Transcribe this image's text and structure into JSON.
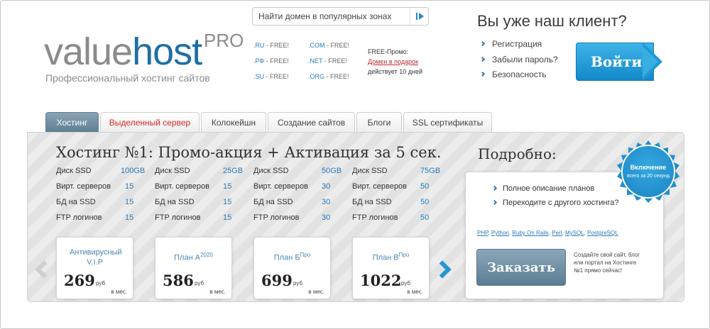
{
  "logo": {
    "part1": "value",
    "part2": "host",
    "pro": "PRO",
    "tagline": "Профессиональный хостинг сайтов"
  },
  "search": {
    "placeholder": "Найти домен в популярных зонах"
  },
  "zones": [
    {
      "zone": ".RU",
      "label": "- FREE!"
    },
    {
      "zone": ".COM",
      "label": "- FREE!"
    },
    {
      "zone": ".РФ",
      "label": "- FREE!"
    },
    {
      "zone": ".NET",
      "label": "- FREE!"
    },
    {
      "zone": ".SU",
      "label": "- FREE!"
    },
    {
      "zone": ".ORG",
      "label": "- FREE!"
    }
  ],
  "promo": {
    "line1": "FREE-Промо:",
    "link": "Домен в подарок",
    "line3": "действует 10 дней"
  },
  "client": {
    "title": "Вы уже наш клиент?",
    "links": [
      "Регистрация",
      "Забыли пароль?",
      "Безопасность"
    ],
    "login": "Войти"
  },
  "tabs": [
    {
      "label": "Хостинг",
      "active": true
    },
    {
      "label": "Выделенный сервер",
      "active": false
    },
    {
      "label": "Колокейшн",
      "active": false
    },
    {
      "label": "Создание сайтов",
      "active": false
    },
    {
      "label": "Блоги",
      "active": false
    },
    {
      "label": "SSL сертификаты",
      "active": false
    }
  ],
  "main": {
    "title": "Хостинг №1: Промо-акция + Активация за 5 сек.",
    "spec_labels": [
      "Диск SSD",
      "Вирт. серверов",
      "БД на SSD",
      "FTP логинов"
    ],
    "spec_columns": [
      [
        "100GB",
        "15",
        "15",
        "15"
      ],
      [
        "25GB",
        "15",
        "15",
        "15"
      ],
      [
        "50GB",
        "30",
        "30",
        "30"
      ],
      [
        "75GB",
        "50",
        "50",
        "50"
      ]
    ],
    "plans": [
      {
        "name": "Антивирусный V.I.P",
        "sup": "",
        "price": "269",
        "currency": "руб",
        "period": "в мес."
      },
      {
        "name": "План А",
        "sup": "2020",
        "price": "586",
        "currency": "руб",
        "period": "в мес."
      },
      {
        "name": "План Б",
        "sup": "Про",
        "price": "699",
        "currency": "руб",
        "period": "в мес."
      },
      {
        "name": "План В",
        "sup": "Про",
        "price": "1022",
        "currency": "руб",
        "period": "в мес."
      }
    ]
  },
  "details": {
    "title": "Подробно:",
    "links": [
      "Полное описание планов",
      "Переходите с другого хостинга?"
    ],
    "techs": [
      "PHP",
      "Python",
      "Ruby On Rails",
      "Perl",
      "MySQL",
      "PostgreSQL"
    ],
    "order": "Заказать",
    "note": "Создайте свой сайт, блог или портал на Хостинге №1 прямо сейчас!"
  },
  "badge": {
    "big": "Включение",
    "small": "всего за 20 секунд"
  },
  "colors": {
    "brand_blue": "#1f6fa6",
    "accent_blue": "#2497d2",
    "tab_red": "#d12a2a"
  }
}
